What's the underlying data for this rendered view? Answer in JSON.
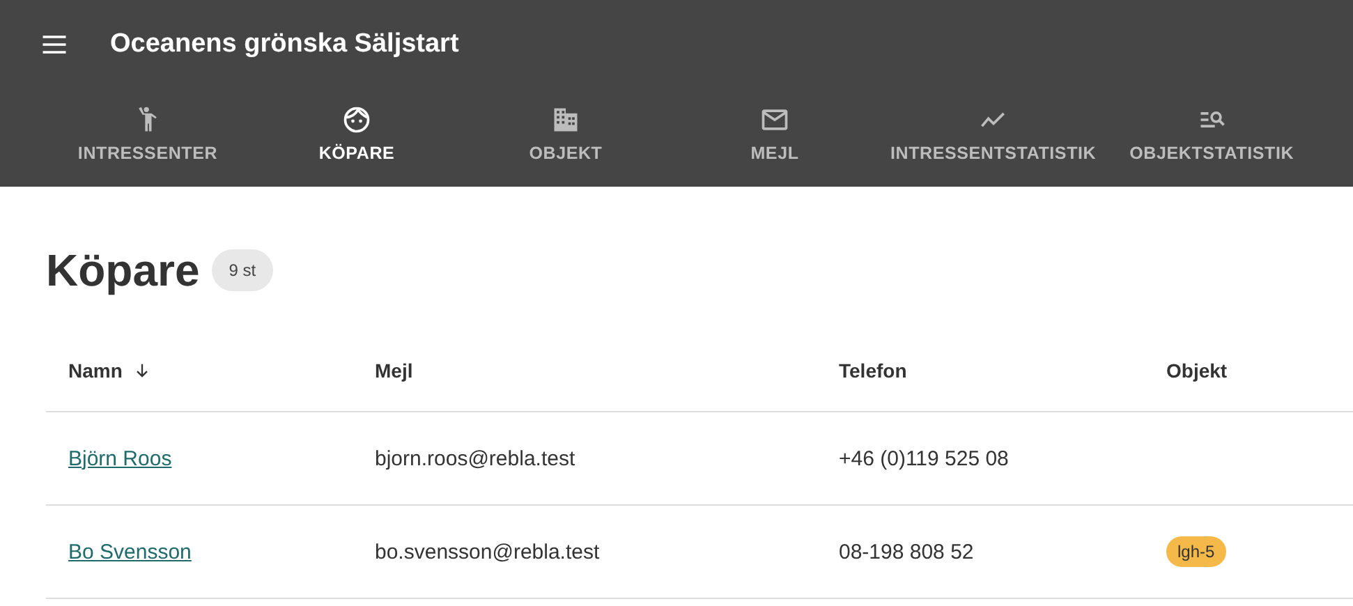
{
  "app_bar": {
    "title": "Oceanens grönska Säljstart"
  },
  "tabs": [
    {
      "label": "INTRESSENTER",
      "selected": false
    },
    {
      "label": "KÖPARE",
      "selected": true
    },
    {
      "label": "OBJEKT",
      "selected": false
    },
    {
      "label": "MEJL",
      "selected": false
    },
    {
      "label": "INTRESSENTSTATISTIK",
      "selected": false
    },
    {
      "label": "OBJEKTSTATISTIK",
      "selected": false
    }
  ],
  "page": {
    "heading": "Köpare",
    "count": "9 st"
  },
  "table": {
    "columns": [
      {
        "label": "Namn",
        "sorted": true
      },
      {
        "label": "Mejl"
      },
      {
        "label": "Telefon"
      },
      {
        "label": "Objekt"
      }
    ],
    "rows": [
      {
        "name": "Björn Roos",
        "email": "bjorn.roos@rebla.test",
        "phone": "+46 (0)119 525 08"
      },
      {
        "name": "Bo Svensson",
        "email": "bo.svensson@rebla.test",
        "phone": "08-198 808 52",
        "objects": [
          "lgh-5"
        ]
      }
    ]
  }
}
